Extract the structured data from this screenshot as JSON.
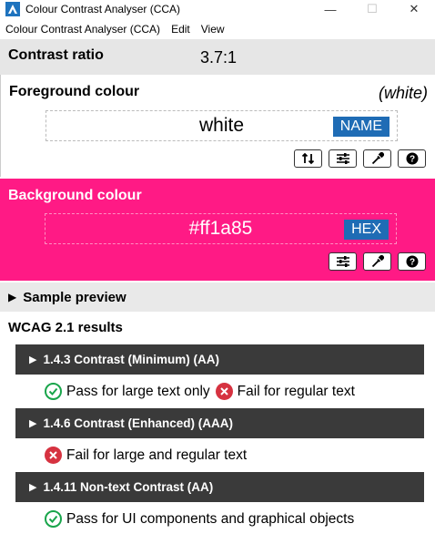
{
  "window": {
    "title": "Colour Contrast Analyser (CCA)",
    "minimize": "—",
    "maximize": "☐",
    "close": "✕"
  },
  "menu": [
    "Colour Contrast Analyser (CCA)",
    "Edit",
    "View"
  ],
  "contrast": {
    "label": "Contrast ratio",
    "value": "3.7:1"
  },
  "foreground": {
    "title": "Foreground colour",
    "name_display": "(white)",
    "input_value": "white",
    "format": "NAME",
    "tools": [
      "swap-icon",
      "sliders-icon",
      "eyedropper-icon",
      "help-icon"
    ]
  },
  "background": {
    "title": "Background colour",
    "input_value": "#ff1a85",
    "format": "HEX",
    "color": "#ff1a85",
    "tools": [
      "sliders-icon",
      "eyedropper-icon",
      "help-icon"
    ]
  },
  "sample": {
    "label": "Sample preview"
  },
  "wcag": {
    "title": "WCAG 2.1 results",
    "criteria": [
      {
        "label": "1.4.3 Contrast (Minimum) (AA)",
        "results": [
          {
            "status": "pass",
            "text": "Pass for large text only"
          },
          {
            "status": "fail",
            "text": "Fail for regular text"
          }
        ]
      },
      {
        "label": "1.4.6 Contrast (Enhanced) (AAA)",
        "results": [
          {
            "status": "fail",
            "text": "Fail for large and regular text"
          }
        ]
      },
      {
        "label": "1.4.11 Non-text Contrast (AA)",
        "results": [
          {
            "status": "pass",
            "text": "Pass for UI components and graphical objects"
          }
        ]
      }
    ]
  }
}
